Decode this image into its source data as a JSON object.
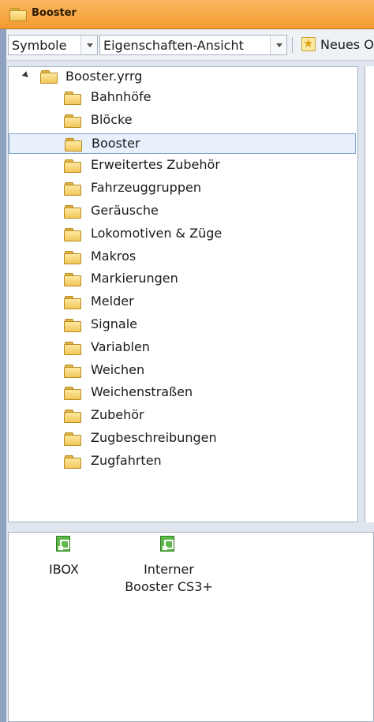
{
  "window": {
    "title": "Booster"
  },
  "toolbar": {
    "view_combo": "Symbole",
    "mode_combo": "Eigenschaften-Ansicht",
    "new_label": "Neues O"
  },
  "tree": {
    "root": "Booster.yrrg",
    "children": [
      "Bahnhöfe",
      "Blöcke",
      "Booster",
      "Erweitertes Zubehör",
      "Fahrzeuggruppen",
      "Geräusche",
      "Lokomotiven & Züge",
      "Makros",
      "Markierungen",
      "Melder",
      "Signale",
      "Variablen",
      "Weichen",
      "Weichenstraßen",
      "Zubehör",
      "Zugbeschreibungen",
      "Zugfahrten"
    ],
    "selected": "Booster"
  },
  "devices": [
    {
      "label": "IBOX",
      "icon": "booster-device-icon"
    },
    {
      "label": "Interner\nBooster CS3+",
      "icon": "booster-device-icon"
    }
  ]
}
